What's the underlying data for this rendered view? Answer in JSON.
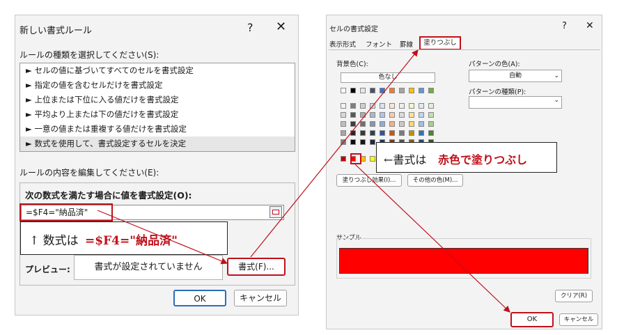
{
  "dialog1": {
    "title": "新しい書式ルール",
    "help": "?",
    "close": "✕",
    "select_rule_label": "ルールの種類を選択してください(S):",
    "rules": [
      "► セルの値に基づいてすべてのセルを書式設定",
      "► 指定の値を含むセルだけを書式設定",
      "► 上位または下位に入る値だけを書式設定",
      "► 平均より上または下の値だけを書式設定",
      "► 一意の値または重複する値だけを書式設定",
      "► 数式を使用して、書式設定するセルを決定"
    ],
    "edit_label": "ルールの内容を編集してください(E):",
    "formula_label": "次の数式を満たす場合に値を書式設定(O):",
    "formula_value": "=$F4=\"納品済\"",
    "preview_label": "プレビュー:",
    "preview_text": "書式が設定されていません",
    "format_button": "書式(F)...",
    "ok": "OK",
    "cancel": "キャンセル"
  },
  "callout1": {
    "prefix": "↑ 数式は",
    "highlight": "=$F4=\"納品済\""
  },
  "dialog2": {
    "title": "セルの書式設定",
    "help": "?",
    "close": "✕",
    "tabs": [
      "表示形式",
      "フォント",
      "罫線",
      "塗りつぶし"
    ],
    "active_tab": 3,
    "bg_color_label": "背景色(C):",
    "no_color": "色なし",
    "pattern_color_label": "パターンの色(A):",
    "pattern_color_value": "自動",
    "pattern_type_label": "パターンの種類(P):",
    "fill_effects_button": "塗りつぶし効果(I)...",
    "more_colors_button": "その他の色(M)...",
    "sample_label": "サンプル",
    "sample_color": "#ff0000",
    "clear_button": "クリア(R)",
    "ok": "OK",
    "cancel": "キャンセル"
  },
  "callout2": {
    "prefix": "←書式は",
    "highlight": "赤色で塗りつぶし"
  },
  "palette": {
    "theme_row": [
      "#ffffff",
      "#000000",
      "#e7e6e6",
      "#44546a",
      "#4472c4",
      "#ed7d31",
      "#a5a5a5",
      "#ffc000",
      "#5b9bd5",
      "#70ad47"
    ],
    "tint_rows": [
      [
        "#f2f2f2",
        "#7f7f7f",
        "#d0cece",
        "#d6dce4",
        "#d9e2f3",
        "#fbe5d5",
        "#ededed",
        "#fff2cc",
        "#deebf6",
        "#e2efd9"
      ],
      [
        "#d8d8d8",
        "#595959",
        "#aeabab",
        "#adb9ca",
        "#b4c6e7",
        "#f7cbac",
        "#dbdbdb",
        "#fee599",
        "#bdd7ee",
        "#c5e0b3"
      ],
      [
        "#bfbfbf",
        "#3f3f3f",
        "#757070",
        "#8496b0",
        "#8eaadb",
        "#f4b183",
        "#c9c9c9",
        "#ffd965",
        "#9cc3e5",
        "#a8d08d"
      ],
      [
        "#a5a5a5",
        "#262626",
        "#3a3838",
        "#323f4f",
        "#2f5496",
        "#c55a11",
        "#7b7b7b",
        "#bf9000",
        "#2e75b5",
        "#538135"
      ],
      [
        "#7f7f7f",
        "#0c0c0c",
        "#171616",
        "#222a35",
        "#1f3763",
        "#833c0b",
        "#525252",
        "#7f6000",
        "#1e4e79",
        "#375623"
      ]
    ],
    "standard_row": [
      "#c00000",
      "#ff0000",
      "#ffc000",
      "#ffff00",
      "#92d050",
      "#00b050",
      "#00b0f0",
      "#0070c0",
      "#002060",
      "#7030a0"
    ],
    "accent_red": "#c0101a"
  }
}
